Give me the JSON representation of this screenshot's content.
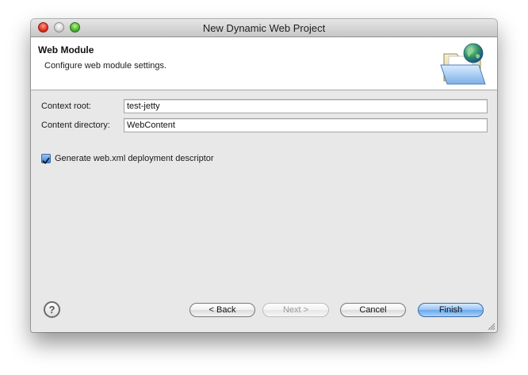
{
  "window": {
    "title": "New Dynamic Web Project"
  },
  "banner": {
    "title": "Web Module",
    "description": "Configure web module settings.",
    "icon": "web-folder-globe-icon"
  },
  "form": {
    "context_root": {
      "label": "Context root:",
      "value": "test-jetty"
    },
    "content_directory": {
      "label": "Content directory:",
      "value": "WebContent"
    },
    "generate_descriptor": {
      "label": "Generate web.xml deployment descriptor",
      "checked": true
    }
  },
  "buttons": {
    "help": "?",
    "back": "< Back",
    "next": "Next >",
    "cancel": "Cancel",
    "finish": "Finish"
  },
  "colors": {
    "accent": "#3f82d6",
    "close": "#e0301e",
    "zoom": "#46b62b"
  }
}
